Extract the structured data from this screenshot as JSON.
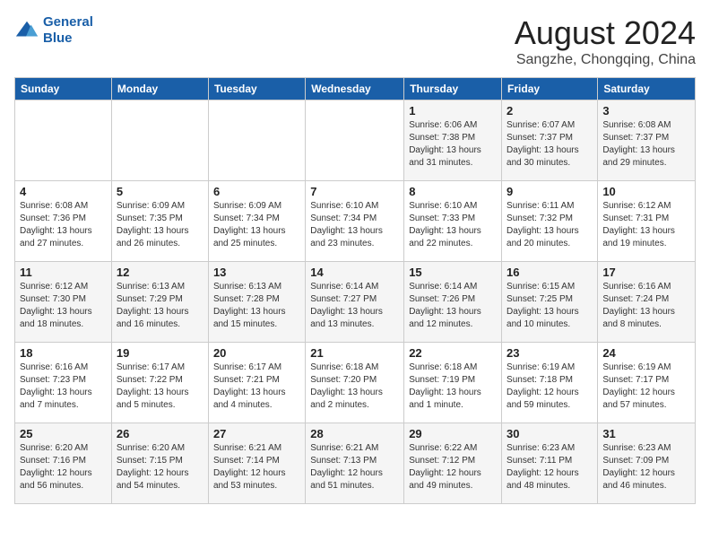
{
  "header": {
    "logo_line1": "General",
    "logo_line2": "Blue",
    "month_year": "August 2024",
    "location": "Sangzhe, Chongqing, China"
  },
  "days_of_week": [
    "Sunday",
    "Monday",
    "Tuesday",
    "Wednesday",
    "Thursday",
    "Friday",
    "Saturday"
  ],
  "weeks": [
    [
      {
        "day": "",
        "info": ""
      },
      {
        "day": "",
        "info": ""
      },
      {
        "day": "",
        "info": ""
      },
      {
        "day": "",
        "info": ""
      },
      {
        "day": "1",
        "info": "Sunrise: 6:06 AM\nSunset: 7:38 PM\nDaylight: 13 hours\nand 31 minutes."
      },
      {
        "day": "2",
        "info": "Sunrise: 6:07 AM\nSunset: 7:37 PM\nDaylight: 13 hours\nand 30 minutes."
      },
      {
        "day": "3",
        "info": "Sunrise: 6:08 AM\nSunset: 7:37 PM\nDaylight: 13 hours\nand 29 minutes."
      }
    ],
    [
      {
        "day": "4",
        "info": "Sunrise: 6:08 AM\nSunset: 7:36 PM\nDaylight: 13 hours\nand 27 minutes."
      },
      {
        "day": "5",
        "info": "Sunrise: 6:09 AM\nSunset: 7:35 PM\nDaylight: 13 hours\nand 26 minutes."
      },
      {
        "day": "6",
        "info": "Sunrise: 6:09 AM\nSunset: 7:34 PM\nDaylight: 13 hours\nand 25 minutes."
      },
      {
        "day": "7",
        "info": "Sunrise: 6:10 AM\nSunset: 7:34 PM\nDaylight: 13 hours\nand 23 minutes."
      },
      {
        "day": "8",
        "info": "Sunrise: 6:10 AM\nSunset: 7:33 PM\nDaylight: 13 hours\nand 22 minutes."
      },
      {
        "day": "9",
        "info": "Sunrise: 6:11 AM\nSunset: 7:32 PM\nDaylight: 13 hours\nand 20 minutes."
      },
      {
        "day": "10",
        "info": "Sunrise: 6:12 AM\nSunset: 7:31 PM\nDaylight: 13 hours\nand 19 minutes."
      }
    ],
    [
      {
        "day": "11",
        "info": "Sunrise: 6:12 AM\nSunset: 7:30 PM\nDaylight: 13 hours\nand 18 minutes."
      },
      {
        "day": "12",
        "info": "Sunrise: 6:13 AM\nSunset: 7:29 PM\nDaylight: 13 hours\nand 16 minutes."
      },
      {
        "day": "13",
        "info": "Sunrise: 6:13 AM\nSunset: 7:28 PM\nDaylight: 13 hours\nand 15 minutes."
      },
      {
        "day": "14",
        "info": "Sunrise: 6:14 AM\nSunset: 7:27 PM\nDaylight: 13 hours\nand 13 minutes."
      },
      {
        "day": "15",
        "info": "Sunrise: 6:14 AM\nSunset: 7:26 PM\nDaylight: 13 hours\nand 12 minutes."
      },
      {
        "day": "16",
        "info": "Sunrise: 6:15 AM\nSunset: 7:25 PM\nDaylight: 13 hours\nand 10 minutes."
      },
      {
        "day": "17",
        "info": "Sunrise: 6:16 AM\nSunset: 7:24 PM\nDaylight: 13 hours\nand 8 minutes."
      }
    ],
    [
      {
        "day": "18",
        "info": "Sunrise: 6:16 AM\nSunset: 7:23 PM\nDaylight: 13 hours\nand 7 minutes."
      },
      {
        "day": "19",
        "info": "Sunrise: 6:17 AM\nSunset: 7:22 PM\nDaylight: 13 hours\nand 5 minutes."
      },
      {
        "day": "20",
        "info": "Sunrise: 6:17 AM\nSunset: 7:21 PM\nDaylight: 13 hours\nand 4 minutes."
      },
      {
        "day": "21",
        "info": "Sunrise: 6:18 AM\nSunset: 7:20 PM\nDaylight: 13 hours\nand 2 minutes."
      },
      {
        "day": "22",
        "info": "Sunrise: 6:18 AM\nSunset: 7:19 PM\nDaylight: 13 hours\nand 1 minute."
      },
      {
        "day": "23",
        "info": "Sunrise: 6:19 AM\nSunset: 7:18 PM\nDaylight: 12 hours\nand 59 minutes."
      },
      {
        "day": "24",
        "info": "Sunrise: 6:19 AM\nSunset: 7:17 PM\nDaylight: 12 hours\nand 57 minutes."
      }
    ],
    [
      {
        "day": "25",
        "info": "Sunrise: 6:20 AM\nSunset: 7:16 PM\nDaylight: 12 hours\nand 56 minutes."
      },
      {
        "day": "26",
        "info": "Sunrise: 6:20 AM\nSunset: 7:15 PM\nDaylight: 12 hours\nand 54 minutes."
      },
      {
        "day": "27",
        "info": "Sunrise: 6:21 AM\nSunset: 7:14 PM\nDaylight: 12 hours\nand 53 minutes."
      },
      {
        "day": "28",
        "info": "Sunrise: 6:21 AM\nSunset: 7:13 PM\nDaylight: 12 hours\nand 51 minutes."
      },
      {
        "day": "29",
        "info": "Sunrise: 6:22 AM\nSunset: 7:12 PM\nDaylight: 12 hours\nand 49 minutes."
      },
      {
        "day": "30",
        "info": "Sunrise: 6:23 AM\nSunset: 7:11 PM\nDaylight: 12 hours\nand 48 minutes."
      },
      {
        "day": "31",
        "info": "Sunrise: 6:23 AM\nSunset: 7:09 PM\nDaylight: 12 hours\nand 46 minutes."
      }
    ]
  ]
}
